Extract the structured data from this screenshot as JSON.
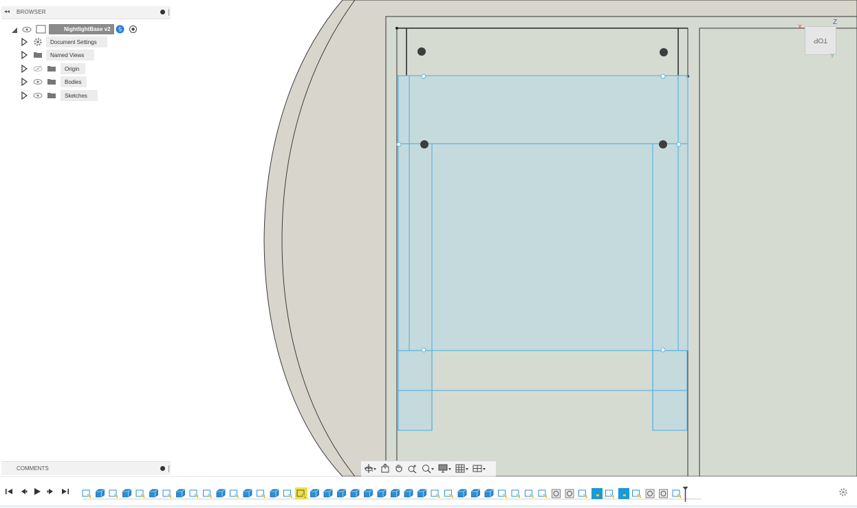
{
  "browser": {
    "title": "BROWSER",
    "root": {
      "label": "NightlightBase v2"
    },
    "items": [
      {
        "label": "Document Settings",
        "icon": "gear-icon",
        "visible": null
      },
      {
        "label": "Named Views",
        "icon": "folder-icon",
        "visible": null
      },
      {
        "label": "Origin",
        "icon": "folder-icon",
        "visible": false
      },
      {
        "label": "Bodies",
        "icon": "folder-icon",
        "visible": true
      },
      {
        "label": "Sketches",
        "icon": "folder-icon",
        "visible": true
      }
    ]
  },
  "comments": {
    "title": "COMMENTS"
  },
  "viewcube": {
    "face_label": "TOP",
    "axis_x": "X",
    "axis_y": "Y",
    "axis_z": "Z"
  },
  "colors": {
    "canvas": "#ffffff",
    "plate_fill": "#d8d6cc",
    "plate_stroke": "#3a3a3a",
    "sketch_blue": "#5ab4e0",
    "sketch_fill": "#b9d8e4",
    "timeline_body": "#2a8fd6",
    "timeline_sketch": "#e8c842",
    "timeline_highlight": "#f0e040"
  },
  "timeline": {
    "features": [
      "s",
      "b",
      "s",
      "b",
      "s",
      "b",
      "s",
      "b",
      "s",
      "s",
      "b",
      "s",
      "b",
      "s",
      "b",
      "s",
      "hl",
      "b",
      "b",
      "b",
      "b",
      "b",
      "b",
      "b",
      "b",
      "b",
      "s",
      "s",
      "b",
      "b",
      "b",
      "s",
      "s",
      "s",
      "s",
      "r",
      "r",
      "s",
      "a",
      "s",
      "a",
      "s",
      "r",
      "r",
      "s"
    ]
  }
}
